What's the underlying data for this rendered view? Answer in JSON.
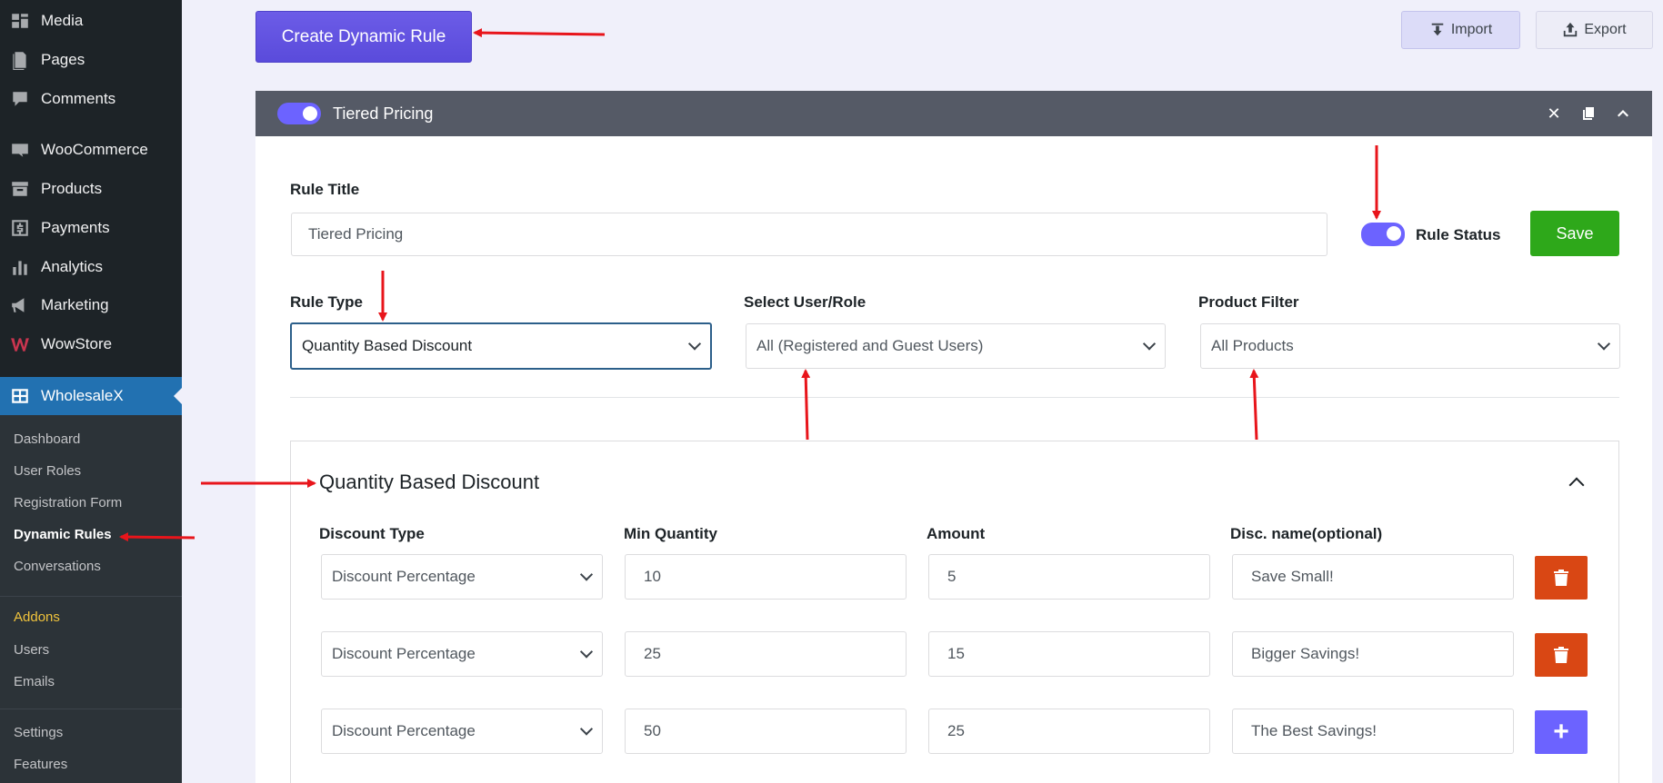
{
  "sidebar": {
    "menu": [
      {
        "label": "Media",
        "icon": "media-icon"
      },
      {
        "label": "Pages",
        "icon": "pages-icon"
      },
      {
        "label": "Comments",
        "icon": "comments-icon"
      },
      {
        "label": "WooCommerce",
        "icon": "woocommerce-icon"
      },
      {
        "label": "Products",
        "icon": "products-icon"
      },
      {
        "label": "Payments",
        "icon": "payments-icon"
      },
      {
        "label": "Analytics",
        "icon": "analytics-icon"
      },
      {
        "label": "Marketing",
        "icon": "marketing-icon"
      },
      {
        "label": "WowStore",
        "icon": "wowstore-icon"
      },
      {
        "label": "WholesaleX",
        "icon": "wholesalex-icon",
        "active": true
      }
    ],
    "submenu": [
      {
        "label": "Dashboard"
      },
      {
        "label": "User Roles"
      },
      {
        "label": "Registration Form"
      },
      {
        "label": "Dynamic Rules",
        "current": true
      },
      {
        "label": "Conversations"
      },
      {
        "label": "Addons",
        "highlight": true
      },
      {
        "label": "Users"
      },
      {
        "label": "Emails"
      },
      {
        "label": "Settings"
      },
      {
        "label": "Features"
      }
    ]
  },
  "toolbar": {
    "create_label": "Create Dynamic Rule",
    "import_label": "Import",
    "export_label": "Export"
  },
  "rule": {
    "header_title": "Tiered Pricing",
    "enabled": true,
    "rule_title_label": "Rule Title",
    "rule_title_value": "Tiered Pricing",
    "rule_status_label": "Rule Status",
    "rule_status_on": true,
    "save_label": "Save",
    "rule_type_label": "Rule Type",
    "rule_type_value": "Quantity Based Discount",
    "user_role_label": "Select User/Role",
    "user_role_value": "All (Registered and Guest Users)",
    "product_filter_label": "Product Filter",
    "product_filter_value": "All Products"
  },
  "discount_section": {
    "title": "Quantity Based Discount",
    "columns": [
      "Discount Type",
      "Min Quantity",
      "Amount",
      "Disc. name(optional)"
    ],
    "tiers": [
      {
        "type": "Discount Percentage",
        "min_qty": "10",
        "amount": "5",
        "name": "Save Small!",
        "action": "delete"
      },
      {
        "type": "Discount Percentage",
        "min_qty": "25",
        "amount": "15",
        "name": "Bigger Savings!",
        "action": "delete"
      },
      {
        "type": "Discount Percentage",
        "min_qty": "50",
        "amount": "25",
        "name": "The Best Savings!",
        "action": "add"
      }
    ]
  },
  "colors": {
    "accent": "#6c63ff",
    "save": "#2ea81a",
    "delete": "#d94714",
    "annotation": "#e8151b"
  }
}
